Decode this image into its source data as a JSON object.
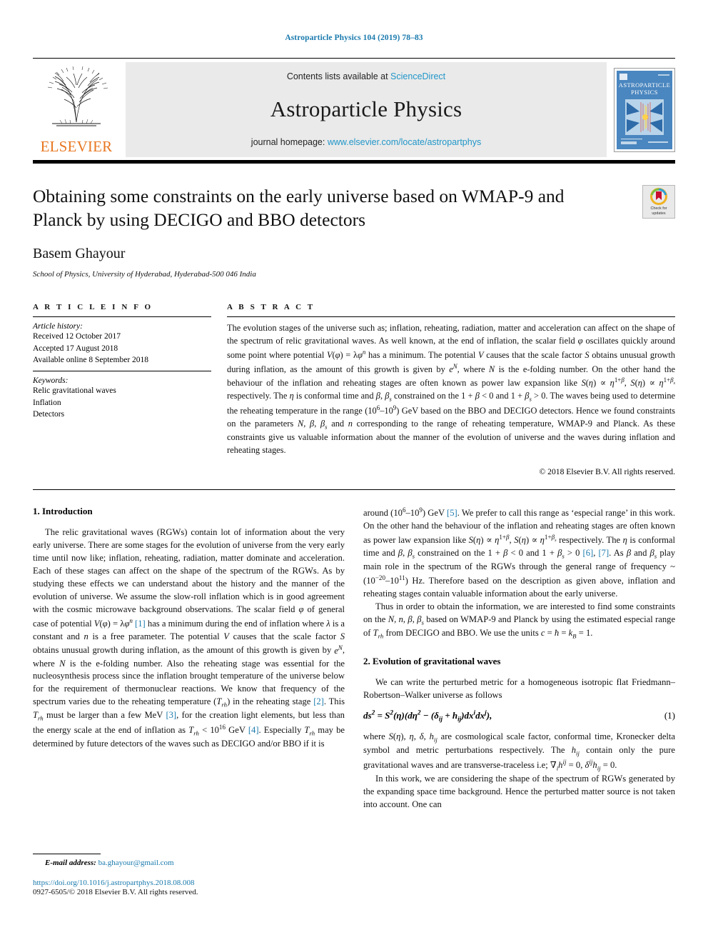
{
  "running_head": "Astroparticle Physics 104 (2019) 78–83",
  "masthead": {
    "publisher_name": "ELSEVIER",
    "contents_prefix": "Contents lists available at ",
    "contents_link": "ScienceDirect",
    "journal_name": "Astroparticle Physics",
    "homepage_prefix": "journal homepage: ",
    "homepage_url": "www.elsevier.com/locate/astropartphys",
    "cover_title_line1": "ASTROPARTICLE",
    "cover_title_line2": "PHYSICS"
  },
  "article": {
    "title": "Obtaining some constraints on the early universe based on WMAP-9 and Planck by using DECIGO and BBO detectors",
    "author": "Basem Ghayour",
    "affiliation": "School of Physics, University of Hyderabad, Hyderabad-500 046 India",
    "crossmark_line1": "Check for",
    "crossmark_line2": "updates"
  },
  "article_info": {
    "heading": "A R T I C L E  I N F O",
    "history_heading": "Article history:",
    "history": [
      "Received 12 October 2017",
      "Accepted 17 August 2018",
      "Available online 8 September 2018"
    ],
    "keywords_heading": "Keywords:",
    "keywords": [
      "Relic gravitational waves",
      "Inflation",
      "Detectors"
    ]
  },
  "abstract": {
    "heading": "A B S T R A C T",
    "copyright": "© 2018 Elsevier B.V. All rights reserved."
  },
  "sections": {
    "intro_heading": "1. Introduction",
    "evolution_heading": "2. Evolution of gravitational waves",
    "equation_number": "(1)"
  },
  "footer": {
    "email_label": "E-mail address:",
    "email": "ba.ghayour@gmail.com",
    "doi": "https://doi.org/10.1016/j.astropartphys.2018.08.008",
    "issn_line": "0927-6505/© 2018 Elsevier B.V. All rights reserved."
  },
  "colors": {
    "link": "#1a7aad",
    "elsevier_orange": "#e87722",
    "masthead_grey": "#eaeaea",
    "cover_blue": "#4a86bf"
  }
}
